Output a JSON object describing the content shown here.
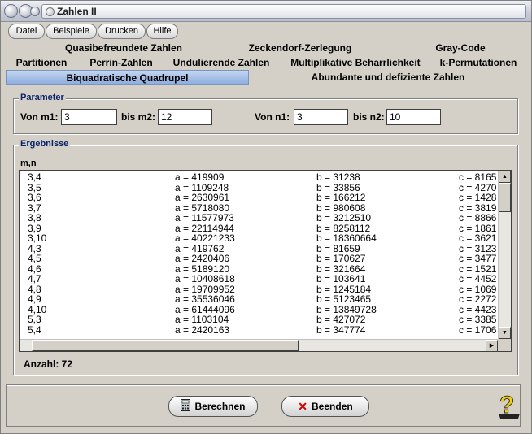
{
  "window": {
    "title": "Zahlen II"
  },
  "menu": [
    "Datei",
    "Beispiele",
    "Drucken",
    "Hilfe"
  ],
  "tabs": {
    "row1": [
      "Quasibefreundete Zahlen",
      "Zeckendorf-Zerlegung",
      "Gray-Code"
    ],
    "row2": [
      "Partitionen",
      "Perrin-Zahlen",
      "Undulierende Zahlen",
      "Multiplikative Beharrlichkeit",
      "k-Permutationen"
    ],
    "row3": [
      "Biquadratische Quadrupel",
      "Abundante und defiziente Zahlen"
    ],
    "active": "Biquadratische Quadrupel"
  },
  "parameter": {
    "title": "Parameter",
    "von_m1_label": "Von m1:",
    "von_m1_value": "3",
    "bis_m2_label": "bis m2:",
    "bis_m2_value": "12",
    "von_n1_label": "Von n1:",
    "von_n1_value": "3",
    "bis_n2_label": "bis n2:",
    "bis_n2_value": "10"
  },
  "results": {
    "title": "Ergebnisse",
    "column_header": "m,n",
    "rows": [
      {
        "mn": "3,4",
        "a": "a = 419909",
        "b": "b = 31238",
        "c": "c = 8165"
      },
      {
        "mn": "3,5",
        "a": "a = 1109248",
        "b": "b = 33856",
        "c": "c = 4270"
      },
      {
        "mn": "3,6",
        "a": "a = 2630961",
        "b": "b = 166212",
        "c": "c = 1428"
      },
      {
        "mn": "3,7",
        "a": "a = 5718080",
        "b": "b = 980608",
        "c": "c = 3819"
      },
      {
        "mn": "3,8",
        "a": "a = 11577973",
        "b": "b = 3212510",
        "c": "c = 8866"
      },
      {
        "mn": "3,9",
        "a": "a = 22114944",
        "b": "b = 8258112",
        "c": "c = 1861"
      },
      {
        "mn": "3,10",
        "a": "a = 40221233",
        "b": "b = 18360664",
        "c": "c = 3621"
      },
      {
        "mn": "4,3",
        "a": "a = 419762",
        "b": "b = 81659",
        "c": "c = 3123"
      },
      {
        "mn": "4,5",
        "a": "a = 2420406",
        "b": "b = 170627",
        "c": "c = 3477"
      },
      {
        "mn": "4,6",
        "a": "a = 5189120",
        "b": "b = 321664",
        "c": "c = 1521"
      },
      {
        "mn": "4,7",
        "a": "a = 10408618",
        "b": "b = 103641",
        "c": "c = 4452"
      },
      {
        "mn": "4,8",
        "a": "a = 19709952",
        "b": "b = 1245184",
        "c": "c = 1069"
      },
      {
        "mn": "4,9",
        "a": "a = 35536046",
        "b": "b = 5123465",
        "c": "c = 2272"
      },
      {
        "mn": "4,10",
        "a": "a = 61444096",
        "b": "b = 13849728",
        "c": "c = 4423"
      },
      {
        "mn": "5,3",
        "a": "a = 1103104",
        "b": "b = 427072",
        "c": "c = 3385"
      },
      {
        "mn": "5,4",
        "a": "a = 2420163",
        "b": "b = 347774",
        "c": "c = 1706"
      }
    ],
    "count_label": "Anzahl: 72"
  },
  "buttons": {
    "berechnen": "Berechnen",
    "beenden": "Beenden"
  },
  "icons": {
    "berechnen": "calculator-icon",
    "beenden": "red-x-icon",
    "help": "question-mark-icon"
  },
  "colors": {
    "active_tab": "#9fb8e4",
    "group_title": "#0a246a",
    "beenden_icon": "#cc0000",
    "help_icon": "#f2d000"
  }
}
